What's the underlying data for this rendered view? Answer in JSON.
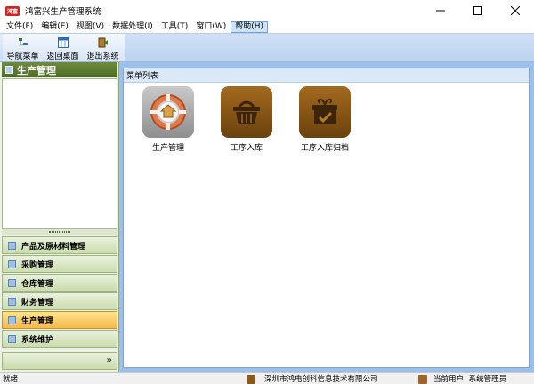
{
  "window": {
    "title": "鸿富兴生产管理系统",
    "app_badge": "鸿富"
  },
  "menu": [
    "文件(F)",
    "编辑(E)",
    "视图(V)",
    "数据处理(I)",
    "工具(T)",
    "窗口(W)",
    "帮助(H)"
  ],
  "toolbar": {
    "nav_menu": "导航菜单",
    "back_desktop": "返回桌面",
    "exit_system": "退出系统"
  },
  "left_panel": {
    "header": "生产管理",
    "nav_items": [
      {
        "label": "产品及原材料管理",
        "active": false
      },
      {
        "label": "采购管理",
        "active": false
      },
      {
        "label": "仓库管理",
        "active": false
      },
      {
        "label": "财务管理",
        "active": false
      },
      {
        "label": "生产管理",
        "active": true
      },
      {
        "label": "系统维护",
        "active": false
      }
    ],
    "more": "»"
  },
  "main": {
    "header": "菜单列表",
    "tiles": [
      {
        "label": "生产管理",
        "icon": "production-gear-icon"
      },
      {
        "label": "工序入库",
        "icon": "basket-icon"
      },
      {
        "label": "工序入库归档",
        "icon": "gift-box-icon"
      }
    ]
  },
  "status": {
    "ready": "就绪",
    "company": "深圳市鸿电创科信息技术有限公司",
    "user": "当前用户: 系统管理员"
  }
}
